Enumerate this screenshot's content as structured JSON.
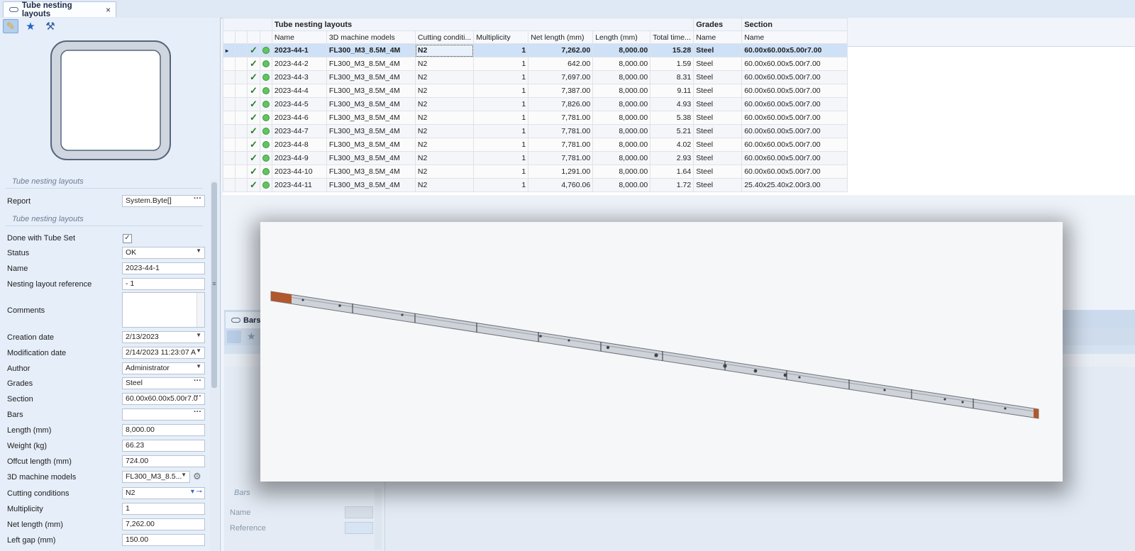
{
  "window": {
    "tab_title": "Tube nesting layouts",
    "tab_close": "×"
  },
  "left_panel": {
    "toolbar": {
      "edit_icon": "✎",
      "star_icon": "★",
      "tools_icon": "⚒"
    },
    "section1_title": "Tube nesting layouts",
    "report_label": "Report",
    "report_value": "System.Byte[]",
    "section2_title": "Tube nesting layouts",
    "props": {
      "done_label": "Done with Tube Set",
      "done_checked": "✓",
      "status_label": "Status",
      "status_value": "OK",
      "name_label": "Name",
      "name_value": "2023-44-1",
      "nesting_ref_label": "Nesting layout reference",
      "nesting_ref_value": "- 1",
      "comments_label": "Comments",
      "creation_label": "Creation date",
      "creation_value": "2/13/2023",
      "modification_label": "Modification date",
      "modification_value": "2/14/2023 11:23:07 A",
      "author_label": "Author",
      "author_value": "Administrator",
      "grades_label": "Grades",
      "grades_value": "Steel",
      "section_label": "Section",
      "section_value": "60.00x60.00x5.00r7.0",
      "bars_label": "Bars",
      "bars_value": "",
      "length_label": "Length (mm)",
      "length_value": "8,000.00",
      "weight_label": "Weight (kg)",
      "weight_value": "66.23",
      "offcut_label": "Offcut length (mm)",
      "offcut_value": "724.00",
      "machine_label": "3D machine models",
      "machine_value": "FL300_M3_8.5...",
      "cutting_label": "Cutting conditions",
      "cutting_value": "N2",
      "multiplicity_label": "Multiplicity",
      "multiplicity_value": "1",
      "net_length_label": "Net length (mm)",
      "net_length_value": "7,262.00",
      "left_gap_label": "Left gap (mm)",
      "left_gap_value": "150.00"
    }
  },
  "grid": {
    "groups": {
      "layouts": "Tube nesting layouts",
      "grades": "Grades",
      "section": "Section"
    },
    "columns": {
      "name": "Name",
      "models": "3D machine models",
      "cutting": "Cutting conditi...",
      "multiplicity": "Multiplicity",
      "net_length": "Net length (mm)",
      "length": "Length (mm)",
      "total_time": "Total time...",
      "grade_name": "Name",
      "section_name": "Name"
    },
    "selected_marker": "▸",
    "check_mark": "✓",
    "rows": [
      {
        "name": "2023-44-1",
        "models": "FL300_M3_8.5M_4M",
        "cutting": "N2",
        "multiplicity": "1",
        "net_length": "7,262.00",
        "length": "8,000.00",
        "total_time": "15.28",
        "grade": "Steel",
        "section": "60.00x60.00x5.00r7.00"
      },
      {
        "name": "2023-44-2",
        "models": "FL300_M3_8.5M_4M",
        "cutting": "N2",
        "multiplicity": "1",
        "net_length": "642.00",
        "length": "8,000.00",
        "total_time": "1.59",
        "grade": "Steel",
        "section": "60.00x60.00x5.00r7.00"
      },
      {
        "name": "2023-44-3",
        "models": "FL300_M3_8.5M_4M",
        "cutting": "N2",
        "multiplicity": "1",
        "net_length": "7,697.00",
        "length": "8,000.00",
        "total_time": "8.31",
        "grade": "Steel",
        "section": "60.00x60.00x5.00r7.00"
      },
      {
        "name": "2023-44-4",
        "models": "FL300_M3_8.5M_4M",
        "cutting": "N2",
        "multiplicity": "1",
        "net_length": "7,387.00",
        "length": "8,000.00",
        "total_time": "9.11",
        "grade": "Steel",
        "section": "60.00x60.00x5.00r7.00"
      },
      {
        "name": "2023-44-5",
        "models": "FL300_M3_8.5M_4M",
        "cutting": "N2",
        "multiplicity": "1",
        "net_length": "7,826.00",
        "length": "8,000.00",
        "total_time": "4.93",
        "grade": "Steel",
        "section": "60.00x60.00x5.00r7.00"
      },
      {
        "name": "2023-44-6",
        "models": "FL300_M3_8.5M_4M",
        "cutting": "N2",
        "multiplicity": "1",
        "net_length": "7,781.00",
        "length": "8,000.00",
        "total_time": "5.38",
        "grade": "Steel",
        "section": "60.00x60.00x5.00r7.00"
      },
      {
        "name": "2023-44-7",
        "models": "FL300_M3_8.5M_4M",
        "cutting": "N2",
        "multiplicity": "1",
        "net_length": "7,781.00",
        "length": "8,000.00",
        "total_time": "5.21",
        "grade": "Steel",
        "section": "60.00x60.00x5.00r7.00"
      },
      {
        "name": "2023-44-8",
        "models": "FL300_M3_8.5M_4M",
        "cutting": "N2",
        "multiplicity": "1",
        "net_length": "7,781.00",
        "length": "8,000.00",
        "total_time": "4.02",
        "grade": "Steel",
        "section": "60.00x60.00x5.00r7.00"
      },
      {
        "name": "2023-44-9",
        "models": "FL300_M3_8.5M_4M",
        "cutting": "N2",
        "multiplicity": "1",
        "net_length": "7,781.00",
        "length": "8,000.00",
        "total_time": "2.93",
        "grade": "Steel",
        "section": "60.00x60.00x5.00r7.00"
      },
      {
        "name": "2023-44-10",
        "models": "FL300_M3_8.5M_4M",
        "cutting": "N2",
        "multiplicity": "1",
        "net_length": "1,291.00",
        "length": "8,000.00",
        "total_time": "1.64",
        "grade": "Steel",
        "section": "60.00x60.00x5.00r7.00"
      },
      {
        "name": "2023-44-11",
        "models": "FL300_M3_8.5M_4M",
        "cutting": "N2",
        "multiplicity": "1",
        "net_length": "4,760.06",
        "length": "8,000.00",
        "total_time": "1.72",
        "grade": "Steel",
        "section": "25.40x25.40x2.00r3.00"
      }
    ]
  },
  "bars_panel": {
    "tab_title": "Bars",
    "section_title": "Bars",
    "name_label": "Name",
    "reference_label": "Reference"
  },
  "colors": {
    "selected_row": "#cfe1f6",
    "status_ok": "#62c462",
    "tube_body": "#cfd3d9",
    "tube_offcut": "#b0582e"
  }
}
